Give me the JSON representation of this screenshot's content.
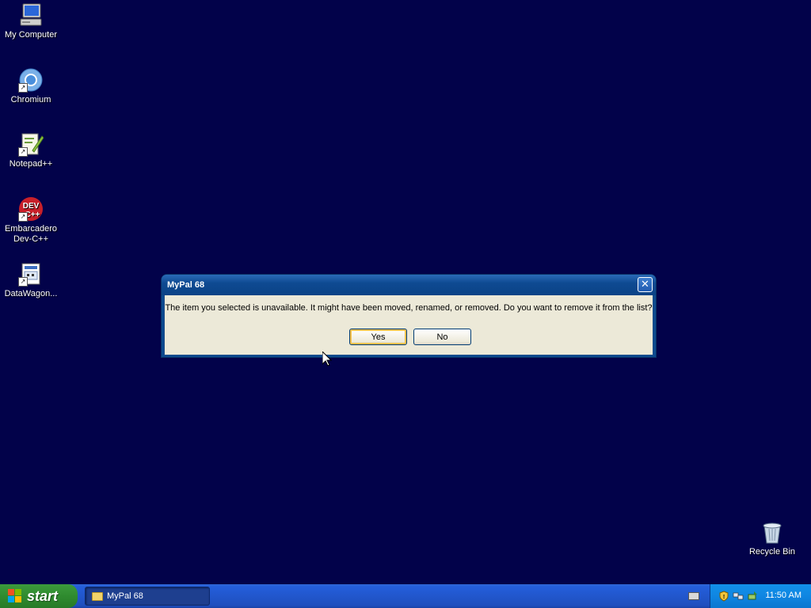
{
  "desktop": {
    "background_color": "#02024a",
    "icons": [
      {
        "label": "My Computer",
        "icon": "my-computer-icon"
      },
      {
        "label": "Chromium",
        "icon": "chromium-icon"
      },
      {
        "label": "Notepad++",
        "icon": "notepad-plus-plus-icon"
      },
      {
        "label": "Embarcadero Dev-C++",
        "icon": "dev-cpp-icon",
        "glyph_top": "DEV",
        "glyph_bottom": "C++"
      },
      {
        "label": "DataWagon...",
        "icon": "datawagon-icon"
      },
      {
        "label": "Recycle Bin",
        "icon": "recycle-bin-icon"
      }
    ]
  },
  "dialog": {
    "title": "MyPal 68",
    "close_glyph": "✕",
    "message": "The item you selected is unavailable.  It might have been moved, renamed, or removed.  Do you want to remove it from the list?",
    "yes_label": "Yes",
    "no_label": "No"
  },
  "taskbar": {
    "start_label": "start",
    "tasks": [
      {
        "label": "MyPal 68",
        "icon": "folder-icon"
      }
    ],
    "clock": "11:50 AM"
  }
}
